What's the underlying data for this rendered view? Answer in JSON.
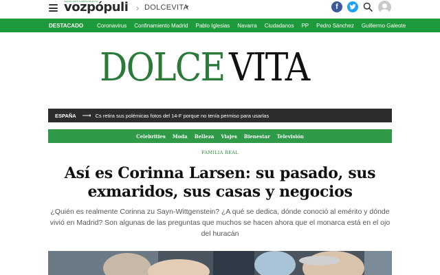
{
  "header": {
    "logo_text": "vozpópuli",
    "logo_tagline": "PERIODISMO INDEPENDIENTE",
    "section": "DOLCEVITA",
    "icons": [
      "menu-icon",
      "facebook-icon",
      "twitter-icon",
      "search-icon",
      "user-avatar-icon"
    ],
    "facebook_glyph": "f"
  },
  "nav": {
    "featured_label": "DESTACADO",
    "items": [
      "Coronavirus",
      "Confinamiento Madrid",
      "Pablo Iglesias",
      "Navarra",
      "Ciudadanos",
      "PP",
      "Pedro Sánchez",
      "Guillermo Galeote"
    ]
  },
  "brand": {
    "part1": "DOLCE",
    "part2": "VITA"
  },
  "ticker": {
    "section": "ESPAÑA",
    "arrow": "⟶",
    "headline": "Cs retira sus polémicas fotos del 14-F porque no tenía permiso para usarlas"
  },
  "section_nav": {
    "items": [
      "Celebrities",
      "Moda",
      "Belleza",
      "Viajes",
      "Bienestar",
      "Televisión"
    ]
  },
  "article": {
    "kicker": "FAMILIA REAL",
    "title": "Así es Corinna Larsen: su pasado, sus exmaridos, sus casas y negocios",
    "lead": "¿Quién es realmente Corinna zu Sayn-Wittgenstein? ¿A qué se dedica, dónde conoció al emérito y dónde vivió en Madrid? Son algunas de las preguntas que muchos se hacen ahora que el monarca está en el ojo del huracán"
  },
  "colors": {
    "brand_green": "#1d9a3b",
    "ticker_bg": "#2d2d2d",
    "section_nav_bg": "#2f9a47",
    "facebook": "#3b5a9a",
    "twitter": "#1da1f2"
  }
}
